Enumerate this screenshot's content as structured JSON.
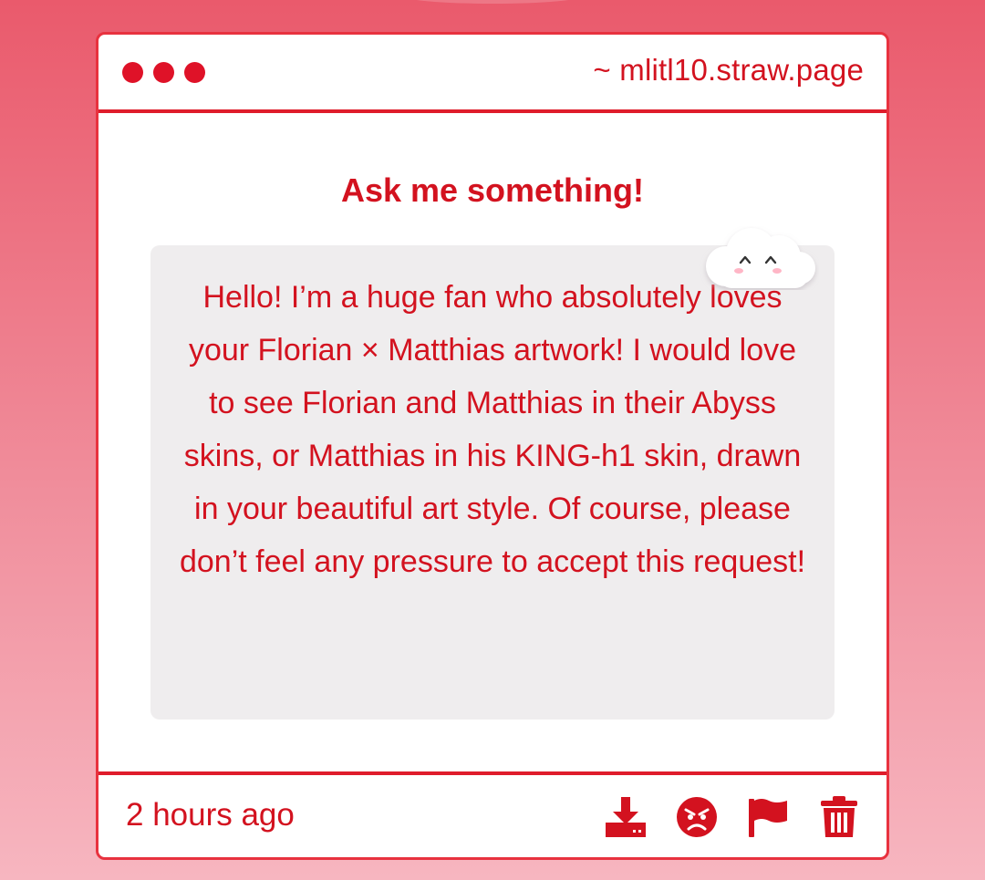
{
  "window": {
    "url": "~ mlitl10.straw.page",
    "dots": [
      "red-dot",
      "red-dot",
      "red-dot"
    ]
  },
  "main": {
    "heading": "Ask me something!",
    "question": "Hello! I’m a huge fan who absolutely loves your Florian × Matthias artwork! I would love to see Florian and Matthias in their Abyss skins, or Matthias in his KING-h1 skin, drawn in your beautiful art style. Of course, please don’t feel any pressure to accept this request!",
    "decoration_icon": "smiling-cloud-icon"
  },
  "footer": {
    "timestamp": "2 hours ago",
    "actions": [
      {
        "name": "download-button",
        "icon": "download-icon"
      },
      {
        "name": "angry-reaction-button",
        "icon": "angry-face-icon"
      },
      {
        "name": "report-button",
        "icon": "flag-icon"
      },
      {
        "name": "delete-button",
        "icon": "trash-icon"
      }
    ]
  },
  "colors": {
    "accent": "#d3121f",
    "border": "#e8323f",
    "question_bg": "#efedee",
    "background_top": "#ea5a6c",
    "background_bottom": "#f7b6c0"
  }
}
